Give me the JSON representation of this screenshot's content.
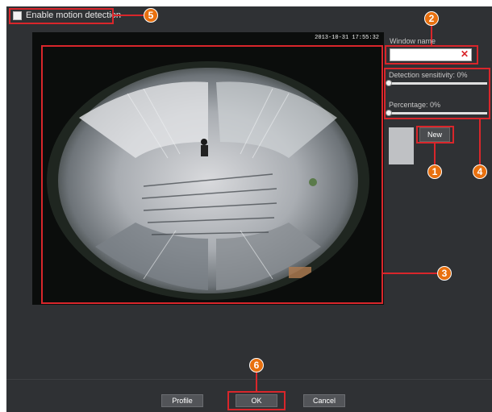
{
  "header": {
    "enable_motion_label": "Enable motion detection",
    "enable_motion_checked": false
  },
  "video": {
    "timestamp": "2013-10-31 17:55:32"
  },
  "right_panel": {
    "window_name_label": "Window name",
    "window_name_value": "",
    "detection_sensitivity_label": "Detection sensitivity: 0%",
    "detection_sensitivity_value": 0,
    "percentage_label": "Percentage: 0%",
    "percentage_value": 0,
    "new_button": "New"
  },
  "footer": {
    "profile_button": "Profile",
    "ok_button": "OK",
    "cancel_button": "Cancel"
  },
  "callouts": {
    "c1": "1",
    "c2": "2",
    "c3": "3",
    "c4": "4",
    "c5": "5",
    "c6": "6"
  },
  "colors": {
    "panel": "#2f3134",
    "callout_red": "#d9262b",
    "badge_orange": "#e8700f"
  },
  "icons": {
    "clear": "close-icon"
  }
}
